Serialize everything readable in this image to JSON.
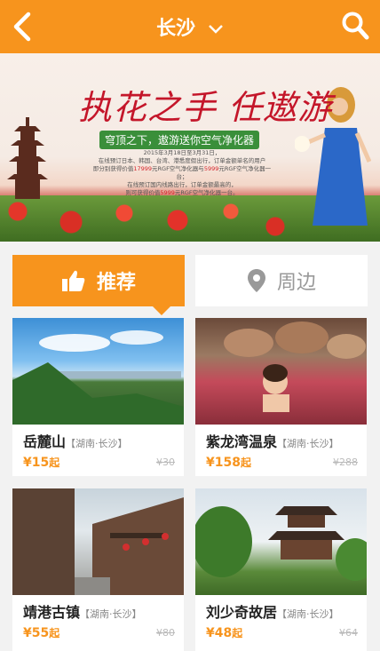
{
  "header": {
    "title": "长沙",
    "title_chevron_icon": "chevron-down-icon",
    "back_icon": "back-arrow-icon",
    "search_icon": "search-icon",
    "bg_color": "#f7941d"
  },
  "banner": {
    "title": "执花之手 任遨游",
    "subtitle": "穹顶之下，遨游送你空气净化器",
    "lines": [
      "2015年3月18日至3月31日，",
      "在线预订日本、韩国、台湾、港悉度假出行，订单金额单名的用户",
      "即分别获得价值",
      "17999",
      "元RGF空气净化器与",
      "5999",
      "元RGF空气净化器一台；",
      "在线预订国内线路出行，订单金额最高的，",
      "则可获得价值",
      "5999",
      "元RGF空气净化器一台。"
    ]
  },
  "tabs": [
    {
      "label": "推荐",
      "icon": "thumbs-up-icon",
      "active": true
    },
    {
      "label": "周边",
      "icon": "location-pin-icon",
      "active": false
    }
  ],
  "cards": [
    {
      "name": "岳麓山",
      "region": "【湖南·长沙】",
      "price": "¥15",
      "price_suffix": "起",
      "original": "¥30"
    },
    {
      "name": "紫龙湾温泉",
      "region": "【湖南·长沙】",
      "price": "¥158",
      "price_suffix": "起",
      "original": "¥288"
    },
    {
      "name": "靖港古镇",
      "region": "【湖南·长沙】",
      "price": "¥55",
      "price_suffix": "起",
      "original": "¥80"
    },
    {
      "name": "刘少奇故居",
      "region": "【湖南·长沙】",
      "price": "¥48",
      "price_suffix": "起",
      "original": "¥64"
    }
  ]
}
